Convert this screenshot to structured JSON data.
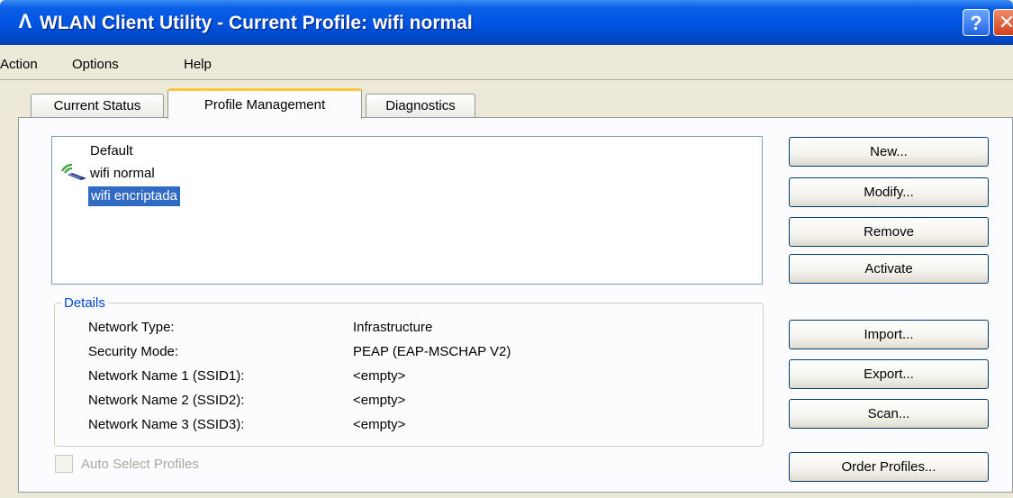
{
  "window": {
    "title": "WLAN Client Utility - Current Profile: wifi normal",
    "app_icon": "Λ",
    "help_glyph": "?",
    "close_glyph": "✕"
  },
  "menu": [
    "Action",
    "Options",
    "Help"
  ],
  "tabs": [
    {
      "label": "Current Status",
      "active": false
    },
    {
      "label": "Profile Management",
      "active": true
    },
    {
      "label": "Diagnostics",
      "active": false
    }
  ],
  "profiles": [
    {
      "name": "Default",
      "selected": false,
      "connected": false
    },
    {
      "name": "wifi normal",
      "selected": false,
      "connected": true
    },
    {
      "name": "wifi encriptada",
      "selected": true,
      "connected": false
    }
  ],
  "buttons": {
    "new": "New...",
    "modify": "Modify...",
    "remove": "Remove",
    "activate": "Activate",
    "import": "Import...",
    "export": "Export...",
    "scan": "Scan...",
    "order_profiles": "Order Profiles..."
  },
  "details": {
    "legend": "Details",
    "rows": [
      {
        "label": "Network Type:",
        "value": "Infrastructure"
      },
      {
        "label": "Security Mode:",
        "value": "PEAP (EAP-MSCHAP V2)"
      },
      {
        "label": "Network Name 1 (SSID1):",
        "value": "<empty>"
      },
      {
        "label": "Network Name 2 (SSID2):",
        "value": "<empty>"
      },
      {
        "label": "Network Name 3 (SSID3):",
        "value": "<empty>"
      }
    ]
  },
  "auto_select": {
    "label": "Auto Select Profiles",
    "checked": false,
    "enabled": false
  },
  "colors": {
    "titlebar": "#0054e3",
    "selection": "#316ac5",
    "group_legend": "#0046d5"
  }
}
